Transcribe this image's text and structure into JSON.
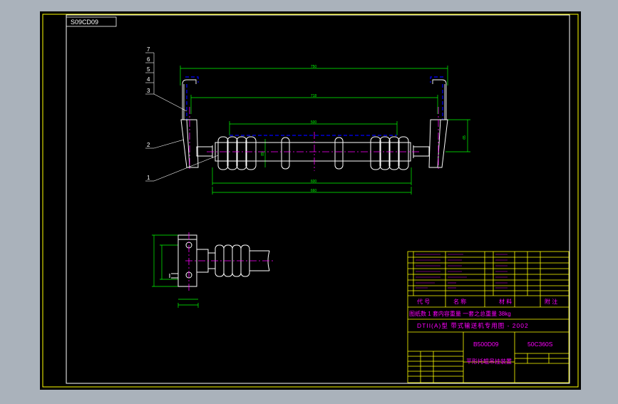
{
  "drawing": {
    "sheet_code": "S09CD09",
    "leaders": [
      "7",
      "6",
      "5",
      "4",
      "3",
      "2",
      "1"
    ],
    "dims": {
      "top_width": "750",
      "inner_width": "718",
      "roller_span": "500",
      "lower_width": "600",
      "bottom_total": "660",
      "bracket_height": "65",
      "roller_dia": "89"
    },
    "title_block": {
      "parts_header": [
        "代 号",
        "名 称",
        "材 料",
        "附 注"
      ],
      "note_line": "图纸数 1 套内容重量 一套之总重量 38kg",
      "company_line": "DTII(A)型 带式输送机专用图 - 2002",
      "drawing_no": "B500D09",
      "code": "50C360S",
      "title": "平形托辊吊挂装置"
    }
  },
  "colors": {
    "background": "#000000",
    "frame": "#ffffff",
    "border": "#ffff00",
    "body": "#ffffff",
    "roller": "#ffffff",
    "dimension": "#00ff00",
    "center": "#ff00ff",
    "hidden": "#0000ff",
    "text": "#ff00ff"
  }
}
